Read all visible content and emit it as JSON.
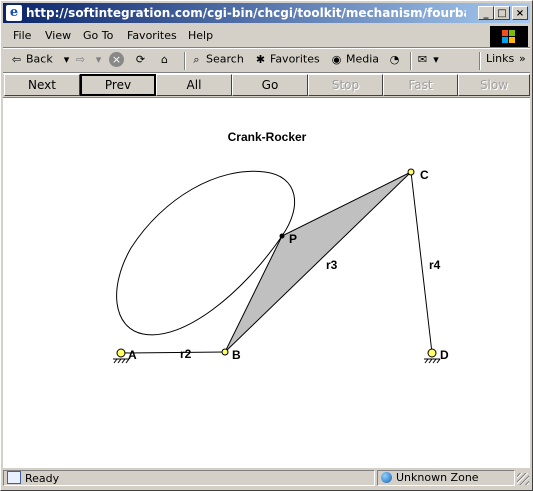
{
  "window": {
    "title": "http://softintegration.com/cgi-bin/chcgi/toolkit/mechanism/fourbar/fourbar...",
    "controls": {
      "minimize": "_",
      "maximize": "□",
      "close": "×"
    }
  },
  "menu": {
    "items": [
      "File",
      "View",
      "Go To",
      "Favorites",
      "Help"
    ]
  },
  "toolbar": {
    "back": "Back",
    "search": "Search",
    "favorites": "Favorites",
    "media": "Media",
    "links": "Links"
  },
  "nav": {
    "buttons": [
      {
        "label": "Next",
        "enabled": true
      },
      {
        "label": "Prev",
        "enabled": true
      },
      {
        "label": "All",
        "enabled": true
      },
      {
        "label": "Go",
        "enabled": true
      },
      {
        "label": "Stop",
        "enabled": false
      },
      {
        "label": "Fast",
        "enabled": false
      },
      {
        "label": "Slow",
        "enabled": false
      }
    ]
  },
  "diagram": {
    "title": "Crank-Rocker",
    "joints": {
      "A": "A",
      "B": "B",
      "C": "C",
      "D": "D",
      "P": "P"
    },
    "links": {
      "r2": "r2",
      "r3": "r3",
      "r4": "r4"
    }
  },
  "status": {
    "text": "Ready",
    "zone": "Unknown Zone"
  },
  "colors": {
    "titlebar_start": "#0a246a",
    "titlebar_end": "#a6caf0",
    "coupler_fill": "#c0c0c0",
    "joint_fill": "#ffff66"
  }
}
